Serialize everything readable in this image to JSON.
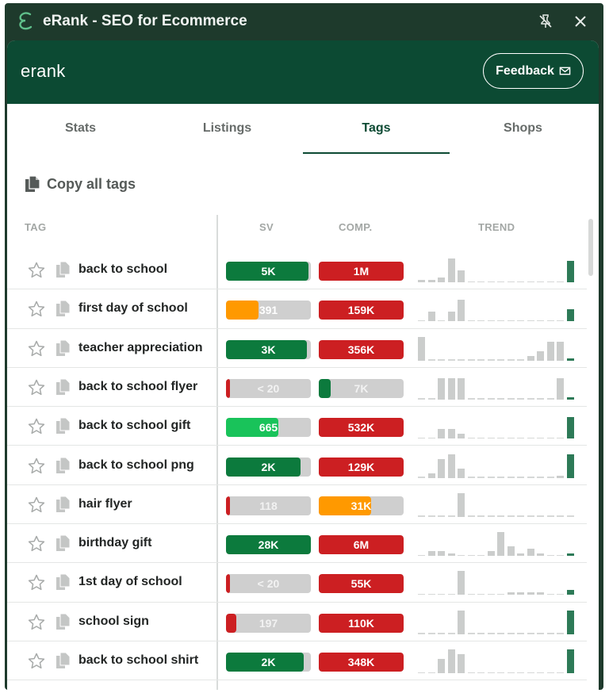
{
  "window": {
    "title": "eRank - SEO for Ecommerce"
  },
  "header": {
    "brand": "erank",
    "feedback_label": "Feedback"
  },
  "tabs": [
    {
      "label": "Stats",
      "active": false
    },
    {
      "label": "Listings",
      "active": false
    },
    {
      "label": "Tags",
      "active": true
    },
    {
      "label": "Shops",
      "active": false
    }
  ],
  "copy_all_label": "Copy all tags",
  "columns": {
    "tag": "TAG",
    "sv": "SV",
    "comp": "COMP.",
    "trend": "TREND"
  },
  "colors": {
    "dark_green": "#0c7a3d",
    "light_green": "#19c35a",
    "red": "#cc1f22",
    "orange": "#ff9900",
    "gray_bar": "#cfcfcf",
    "trend_gray": "#cbcdcc",
    "trend_green": "#2d7a57"
  },
  "rows": [
    {
      "tag": "back to school",
      "sv": {
        "label": "5K",
        "level": 0.97,
        "color": "#0c7a3d"
      },
      "comp": {
        "label": "1M",
        "level": 1.0,
        "color": "#cc1f22"
      },
      "trend": [
        1,
        1,
        2,
        10,
        5,
        0,
        0,
        0,
        0,
        0,
        0,
        0,
        0,
        0,
        0,
        9
      ]
    },
    {
      "tag": "first day of school",
      "sv": {
        "label": "391",
        "level": 0.38,
        "color": "#ff9900"
      },
      "comp": {
        "label": "159K",
        "level": 1.0,
        "color": "#cc1f22"
      },
      "trend": [
        0,
        4,
        0,
        4,
        9,
        0,
        0,
        0,
        0,
        0,
        0,
        0,
        0,
        0,
        0,
        5
      ]
    },
    {
      "tag": "teacher appreciation",
      "sv": {
        "label": "3K",
        "level": 0.95,
        "color": "#0c7a3d"
      },
      "comp": {
        "label": "356K",
        "level": 1.0,
        "color": "#cc1f22"
      },
      "trend": [
        10,
        0,
        0,
        0,
        0,
        0,
        0,
        0,
        0,
        0,
        0,
        2,
        4,
        8,
        8,
        1
      ]
    },
    {
      "tag": "back to school flyer",
      "sv": {
        "label": "< 20",
        "level": 0.05,
        "color": "#cc1f22"
      },
      "comp": {
        "label": "7K",
        "level": 0.14,
        "color": "#0c7a3d"
      },
      "trend": [
        0,
        0,
        9,
        9,
        9,
        0,
        0,
        0,
        0,
        0,
        0,
        0,
        0,
        0,
        9,
        1
      ]
    },
    {
      "tag": "back to school gift",
      "sv": {
        "label": "665",
        "level": 0.62,
        "color": "#19c35a"
      },
      "comp": {
        "label": "532K",
        "level": 1.0,
        "color": "#cc1f22"
      },
      "trend": [
        0,
        0,
        4,
        4,
        2,
        0,
        0,
        0,
        0,
        0,
        0,
        0,
        0,
        0,
        0,
        9
      ]
    },
    {
      "tag": "back to school png",
      "sv": {
        "label": "2K",
        "level": 0.88,
        "color": "#0c7a3d"
      },
      "comp": {
        "label": "129K",
        "level": 1.0,
        "color": "#cc1f22"
      },
      "trend": [
        0,
        2,
        8,
        10,
        4,
        0,
        0,
        0,
        0,
        0,
        0,
        0,
        0,
        0,
        1,
        10
      ]
    },
    {
      "tag": "hair flyer",
      "sv": {
        "label": "118",
        "level": 0.05,
        "color": "#cc1f22"
      },
      "comp": {
        "label": "31K",
        "level": 0.62,
        "color": "#ff9900"
      },
      "trend": [
        0,
        0,
        0,
        0,
        10,
        0,
        0,
        0,
        0,
        0,
        0,
        0,
        0,
        0,
        0,
        0
      ]
    },
    {
      "tag": "birthday gift",
      "sv": {
        "label": "28K",
        "level": 1.0,
        "color": "#0c7a3d"
      },
      "comp": {
        "label": "6M",
        "level": 1.0,
        "color": "#cc1f22"
      },
      "trend": [
        0,
        2,
        2,
        1,
        0,
        0,
        0,
        2,
        10,
        4,
        1,
        3,
        1,
        0,
        0,
        1
      ]
    },
    {
      "tag": "1st day of school",
      "sv": {
        "label": "< 20",
        "level": 0.05,
        "color": "#cc1f22"
      },
      "comp": {
        "label": "55K",
        "level": 1.0,
        "color": "#cc1f22"
      },
      "trend": [
        0,
        0,
        0,
        0,
        10,
        0,
        0,
        0,
        0,
        1,
        1,
        1,
        1,
        0,
        0,
        2
      ]
    },
    {
      "tag": "school sign",
      "sv": {
        "label": "197",
        "level": 0.12,
        "color": "#cc1f22"
      },
      "comp": {
        "label": "110K",
        "level": 1.0,
        "color": "#cc1f22"
      },
      "trend": [
        0,
        0,
        0,
        0,
        10,
        0,
        0,
        0,
        0,
        0,
        0,
        0,
        0,
        0,
        0,
        10
      ]
    },
    {
      "tag": "back to school shirt",
      "sv": {
        "label": "2K",
        "level": 0.92,
        "color": "#0c7a3d"
      },
      "comp": {
        "label": "348K",
        "level": 1.0,
        "color": "#cc1f22"
      },
      "trend": [
        0,
        0,
        6,
        10,
        8,
        0,
        0,
        0,
        0,
        0,
        0,
        0,
        0,
        0,
        0,
        10
      ]
    }
  ]
}
